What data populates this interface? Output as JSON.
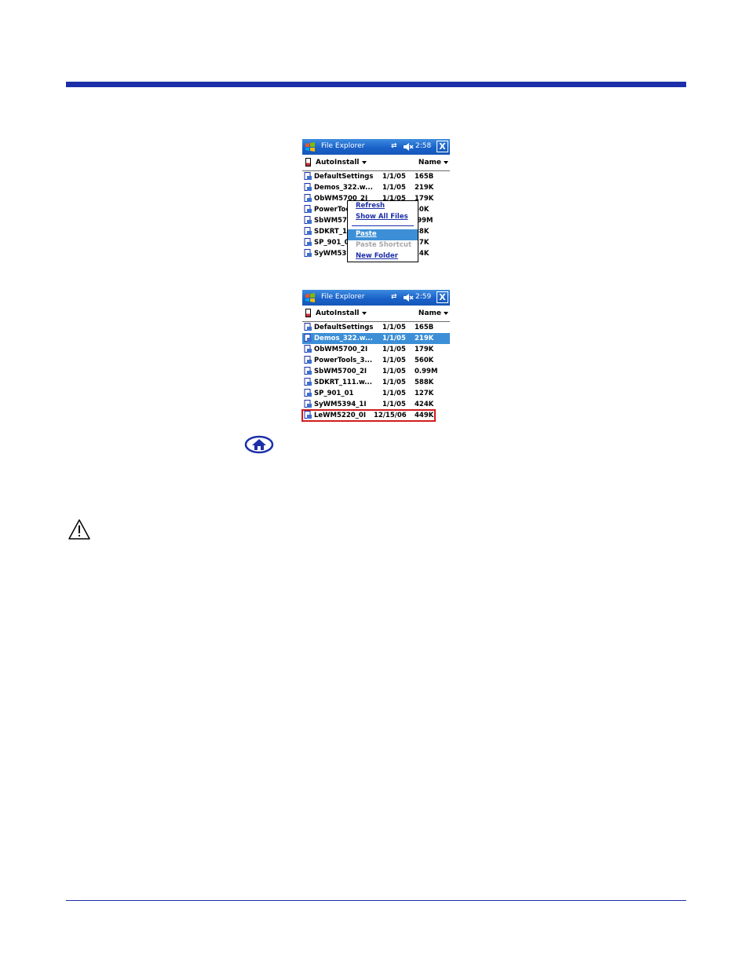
{
  "screens": [
    {
      "title": "File Explorer",
      "time": "2:58",
      "close_label": "X",
      "folder": "AutoInstall",
      "sort": "Name",
      "rows": [
        {
          "name": "DefaultSettings",
          "date": "1/1/05",
          "size": "165B"
        },
        {
          "name": "Demos_322.w...",
          "date": "1/1/05",
          "size": "219K"
        },
        {
          "name": "ObWM5700_2I",
          "date": "1/1/05",
          "size": "179K"
        },
        {
          "name": "PowerToo",
          "date": "",
          "size": "60K"
        },
        {
          "name": "SbWM570",
          "date": "",
          "size": ".99M"
        },
        {
          "name": "SDKRT_1",
          "date": "",
          "size": "88K"
        },
        {
          "name": "SP_901_0",
          "date": "",
          "size": "27K"
        },
        {
          "name": "SyWM539",
          "date": "",
          "size": "24K"
        }
      ],
      "context_menu": [
        "Refresh",
        "Show All Files",
        "Paste",
        "Paste Shortcut",
        "New Folder"
      ]
    },
    {
      "title": "File Explorer",
      "time": "2:59",
      "close_label": "X",
      "folder": "AutoInstall",
      "sort": "Name",
      "rows": [
        {
          "name": "DefaultSettings",
          "date": "1/1/05",
          "size": "165B"
        },
        {
          "name": "Demos_322.w...",
          "date": "1/1/05",
          "size": "219K"
        },
        {
          "name": "ObWM5700_2I",
          "date": "1/1/05",
          "size": "179K"
        },
        {
          "name": "PowerTools_3...",
          "date": "1/1/05",
          "size": "560K"
        },
        {
          "name": "SbWM5700_2I",
          "date": "1/1/05",
          "size": "0.99M"
        },
        {
          "name": "SDKRT_111.w...",
          "date": "1/1/05",
          "size": "588K"
        },
        {
          "name": "SP_901_01",
          "date": "1/1/05",
          "size": "127K"
        },
        {
          "name": "SyWM5394_1I",
          "date": "1/1/05",
          "size": "424K"
        },
        {
          "name": "LeWM5220_0I",
          "date": "12/15/06",
          "size": "449K"
        }
      ]
    }
  ],
  "icons": {
    "home": "home-icon",
    "caution": "caution-icon",
    "start": "windows-start-icon",
    "connectivity": "connectivity-icon",
    "volume": "volume-muted-icon",
    "file": "file-icon"
  },
  "colors": {
    "rule": "#1c2fa8",
    "titlebar": "#1a62c9",
    "highlight": "#3c8fd7",
    "callout": "#d21c1c"
  }
}
